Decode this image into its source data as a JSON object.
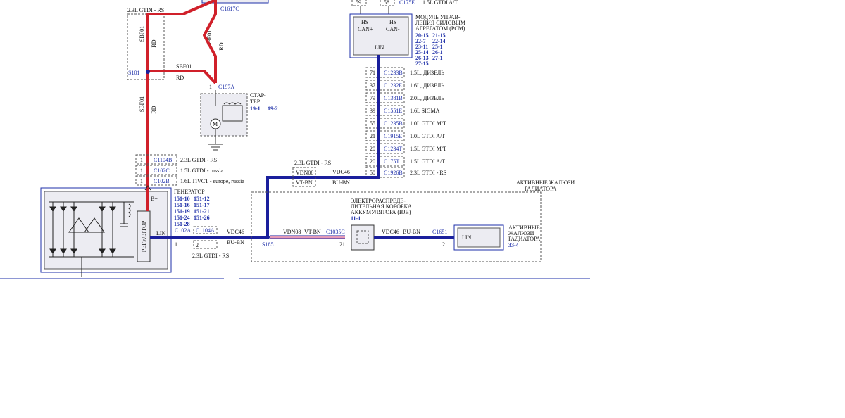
{
  "top": {
    "connector_top": "C1617C",
    "pin_59": "59",
    "pin_58": "58",
    "c175e_top": "C175E",
    "engine_top": "1.5L GTDI A/T"
  },
  "fuse_group": {
    "variant": "2.3L GTDI - RS",
    "wire_sbf01_left": "SBF01",
    "wire_rd_left": "RD",
    "wire_sbf01_mid": "SBF01",
    "wire_rd_mid": "RD",
    "wire_sbf01_horiz": "SBF01",
    "wire_rd_horiz": "RD",
    "wire_sbf01_low": "SBF01",
    "wire_rd_low": "RD",
    "splice": "S101"
  },
  "starter": {
    "pin": "1",
    "connector": "C197A",
    "label_line1": "СТАР-",
    "label_line2": "ТЕР",
    "ref1": "19-1",
    "ref2": "19-2"
  },
  "pcm": {
    "hs_can_plus_1": "HS",
    "hs_can_plus_2": "CAN+",
    "hs_can_minus_1": "HS",
    "hs_can_minus_2": "CAN-",
    "lin": "LIN",
    "title_line1": "МОДУЛЬ УПРАВ-",
    "title_line2": "ЛЕНИЯ СИЛОВЫМ",
    "title_line3": "АГРЕГАТОМ (PCM)",
    "refs": [
      [
        "20-15",
        "21-15"
      ],
      [
        "22-7",
        "22-14"
      ],
      [
        "23-11",
        "25-1"
      ],
      [
        "25-14",
        "26-1"
      ],
      [
        "26-13",
        "27-1"
      ],
      [
        "27-15",
        ""
      ]
    ]
  },
  "pcm_connectors": [
    {
      "pin": "71",
      "conn": "C1233B",
      "label": "1.5L, ДИЗЕЛЬ"
    },
    {
      "pin": "37",
      "conn": "C1232E",
      "label": "1.6L, ДИЗЕЛЬ"
    },
    {
      "pin": "79",
      "conn": "C1381B",
      "label": "2.0L, ДИЗЕЛЬ"
    },
    {
      "pin": "39",
      "conn": "C1551E",
      "label": "1.6L SIGMA"
    },
    {
      "pin": "55",
      "conn": "C1235B",
      "label": "1.0L GTDI M/T"
    },
    {
      "pin": "21",
      "conn": "C1915E",
      "label": "1.0L GTDI A/T"
    },
    {
      "pin": "20",
      "conn": "C1234T",
      "label": "1.5L GTDI M/T"
    },
    {
      "pin": "20",
      "conn": "C175T",
      "label": "1.5L GTDI A/T"
    },
    {
      "pin": "50",
      "conn": "C1926B",
      "label": "2.3L GTDI - RS"
    }
  ],
  "alt_connectors": [
    {
      "pin": "1",
      "conn": "C1104B",
      "label": "2.3L GTDI - RS"
    },
    {
      "pin": "1",
      "conn": "C102C",
      "label": "1.5L GTDI - russia"
    },
    {
      "pin": "1",
      "conn": "C102B",
      "label": "1.6L TIVCT - europe, russia"
    }
  ],
  "generator": {
    "title": "ГЕНЕРАТОР",
    "bplus": "B+",
    "lin": "LIN",
    "regulator": "РЕГУЛЯТОР",
    "refs": [
      [
        "151-10",
        "151-12"
      ],
      [
        "151-16",
        "151-17"
      ],
      [
        "151-19",
        "151-21"
      ],
      [
        "151-24",
        "151-26"
      ],
      [
        "151-28",
        ""
      ]
    ]
  },
  "lin_line": {
    "c102a": "C102A",
    "c1104a": "C1104A",
    "pin1": "1",
    "pin2": "2",
    "variant": "2.3L GTDI - RS",
    "vdc46": "VDC46",
    "bu_bn": "BU-BN",
    "splice": "S185"
  },
  "vdn_box": {
    "variant": "2.3L GTDI - RS",
    "vdn08": "VDN08",
    "vt_bn": "VT-BN",
    "vdc46": "VDC46",
    "bu_bn": "BU-BN"
  },
  "shutter_group": {
    "title_line1": "АКТИВНЫЕ ЖАЛЮЗИ",
    "title_line2": "РАДИАТОРА",
    "vdn08": "VDN08",
    "vt_bn": "VT-BN",
    "c1035c": "C1035C",
    "pin21": "21",
    "bjb_line1": "ЭЛЕКТРОРАСПРЕДЕ-",
    "bjb_line2": "ЛИТЕЛЬНАЯ КОРОБКА",
    "bjb_line3": "АККУМУЛЯТОРА (BJB)",
    "bjb_ref": "11-1",
    "vdc46": "VDC46",
    "bu_bn": "BU-BN",
    "c1651": "C1651",
    "pin2": "2",
    "lin": "LIN",
    "grille_line1": "АКТИВНЫЕ",
    "grille_line2": "ЖАЛЮЗИ",
    "grille_line3": "РАДИАТОРА",
    "grille_ref": "33-4"
  },
  "colors": {
    "red_wire": "#d0202a",
    "blue_wire": "#1a1f9c",
    "pink_wire": "#e59ab8",
    "ref_blue": "#1e2fa8"
  }
}
